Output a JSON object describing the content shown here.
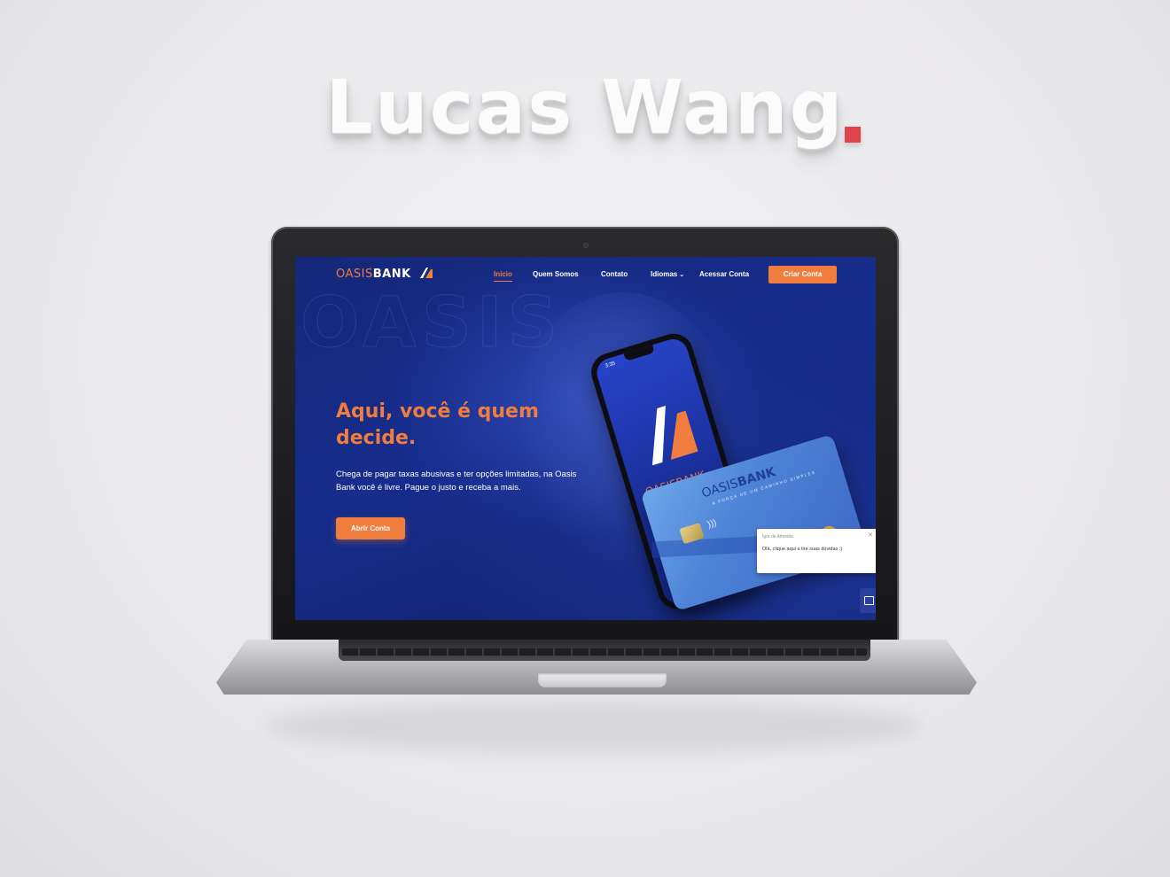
{
  "showcase": {
    "title": "Lucas Wang",
    "accent_color": "#e0434a"
  },
  "site": {
    "brand": {
      "part1": "OASIS",
      "part2": "BANK"
    },
    "nav": {
      "items": [
        {
          "label": "Início",
          "active": true
        },
        {
          "label": "Quem Somos",
          "active": false
        },
        {
          "label": "Contato",
          "active": false
        },
        {
          "label": "Idiomas",
          "active": false,
          "dropdown": true
        },
        {
          "label": "Acessar Conta",
          "active": false
        }
      ],
      "cta": "Criar Conta"
    },
    "hero": {
      "title": "Aqui, você é quem decide.",
      "text": "Chega de pagar taxas abusivas e ter opções limitadas, na Oasis Bank você é livre. Pague o justo e receba a mais.",
      "button": "Abrir Conta"
    },
    "phone": {
      "time": "3:35",
      "brand": "OASISBANK"
    },
    "card": {
      "brand_part1": "OASIS",
      "brand_part2": "BANK",
      "tagline": "A FORÇA DE UM CAMINHO SIMPLES"
    },
    "chat": {
      "agent": "Igor de Almeida",
      "message": "Olá, clique aqui e tire suas dúvidas :)"
    },
    "colors": {
      "brand_orange": "#f07c3e",
      "brand_blue": "#172d8c",
      "card_blue": "#4f84d8"
    },
    "icons": [
      "logo-mark-icon",
      "chevron-down-icon",
      "contactless-icon",
      "close-icon",
      "chat-icon"
    ]
  }
}
